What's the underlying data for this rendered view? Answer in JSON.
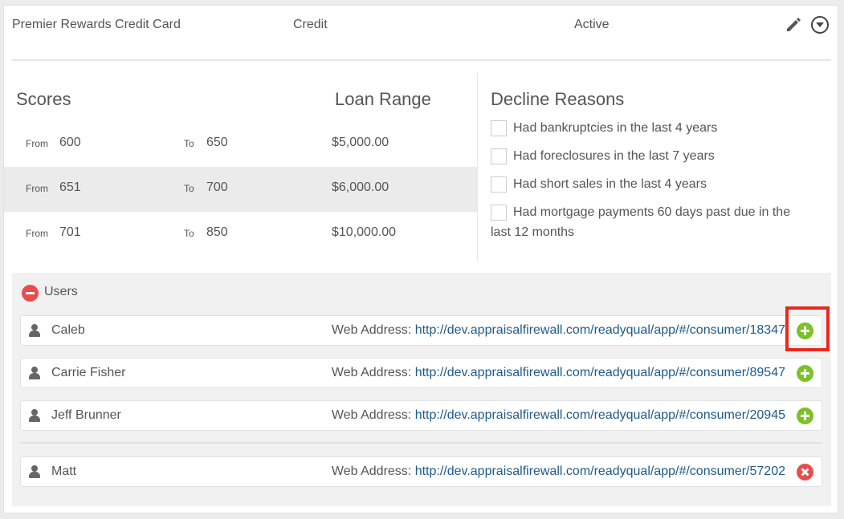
{
  "header": {
    "product_name": "Premier Rewards Credit Card",
    "type": "Credit",
    "status": "Active",
    "icons": [
      "pencil-icon",
      "chevron-down-circle-icon"
    ]
  },
  "scores": {
    "title": "Scores",
    "loan_range_title": "Loan Range",
    "from_label": "From",
    "to_label": "To",
    "rows": [
      {
        "from": "600",
        "to": "650",
        "loan": "$5,000.00"
      },
      {
        "from": "651",
        "to": "700",
        "loan": "$6,000.00"
      },
      {
        "from": "701",
        "to": "850",
        "loan": "$10,000.00"
      }
    ]
  },
  "decline": {
    "title": "Decline Reasons",
    "items": [
      "Had bankruptcies in the last 4 years",
      "Had foreclosures in the last 7 years",
      "Had short sales in the last 4 years",
      "Had mortgage payments 60 days past due in the last 12 months"
    ]
  },
  "users": {
    "label": "Users",
    "web_address_label": "Web Address:",
    "list": [
      {
        "name": "Caleb",
        "url": "http://dev.appraisalfirewall.com/readyqual/app/#/consumer/18347",
        "action": "add"
      },
      {
        "name": "Carrie Fisher",
        "url": "http://dev.appraisalfirewall.com/readyqual/app/#/consumer/89547",
        "action": "add"
      },
      {
        "name": "Jeff Brunner",
        "url": "http://dev.appraisalfirewall.com/readyqual/app/#/consumer/20945",
        "action": "add"
      },
      {
        "name": "Matt",
        "url": "http://dev.appraisalfirewall.com/readyqual/app/#/consumer/57202",
        "action": "remove"
      }
    ]
  },
  "colors": {
    "add": "#7cc127",
    "remove": "#e94c4c",
    "link": "#1e5a8a",
    "highlight": "#e8291c"
  }
}
